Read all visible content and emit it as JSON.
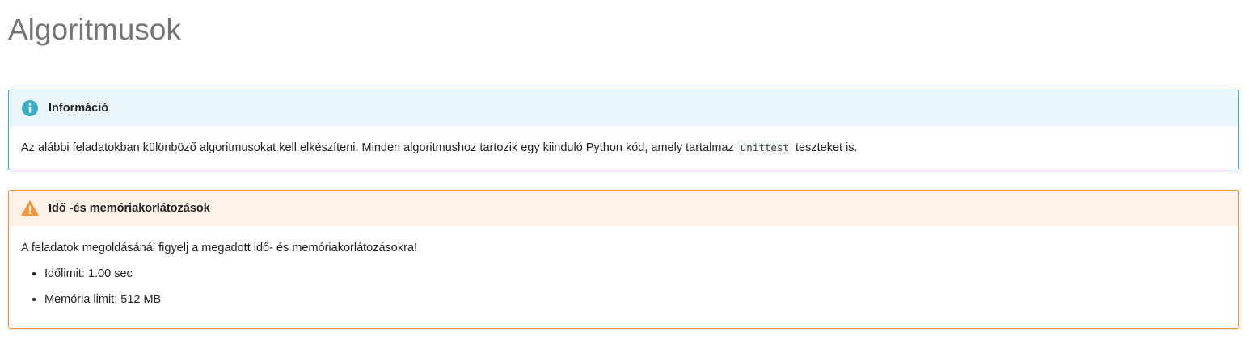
{
  "page": {
    "title": "Algoritmusok"
  },
  "info_box": {
    "icon": "info-icon",
    "title": "Információ",
    "text_before_code": "Az alábbi feladatokban különböző algoritmusokat kell elkészíteni. Minden algoritmushoz tartozik egy kiinduló Python kód, amely tartalmaz ",
    "code": "unittest",
    "text_after_code": " teszteket is.",
    "color": "#3aaec6",
    "header_bg": "#eaf6f9"
  },
  "warning_box": {
    "icon": "warning-icon",
    "title": "Idő -és memóriakorlátozások",
    "text": "A feladatok megoldásánál figyelj a megadott idő- és memóriakorlátozásokra!",
    "items": [
      "Időlimit: 1.00 sec",
      "Memória limit: 512 MB"
    ],
    "color": "#f0953a",
    "header_bg": "#fdf1e8"
  }
}
